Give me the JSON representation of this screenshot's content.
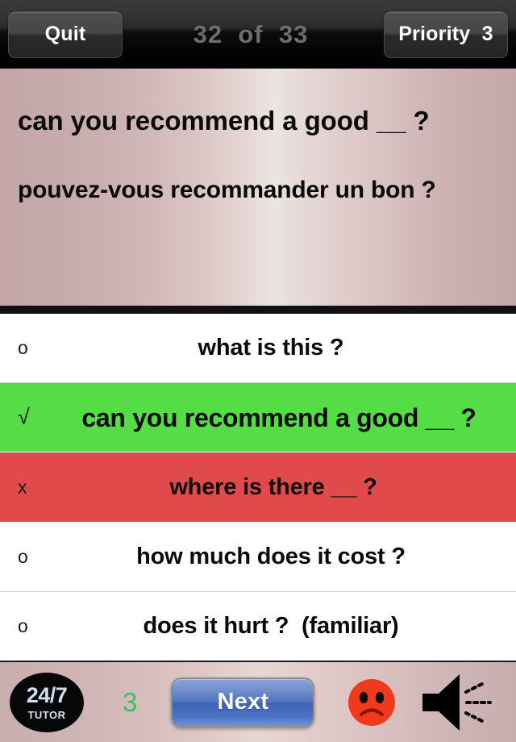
{
  "topbar": {
    "quit_label": "Quit",
    "counter": "32  of  33",
    "current_index": 32,
    "total": 33,
    "priority_label": "Priority  3"
  },
  "question": {
    "prompt_en": "can you recommend a good __ ?",
    "prompt_fr": "pouvez-vous recommander un bon ?"
  },
  "answers": [
    {
      "marker": "o",
      "text": "what is this ?",
      "state": "neutral"
    },
    {
      "marker": "√",
      "text": "can you recommend a good __ ?",
      "state": "correct"
    },
    {
      "marker": "x",
      "text": "where is there __ ?",
      "state": "wrong"
    },
    {
      "marker": "o",
      "text": "how much does it cost ?",
      "state": "neutral"
    },
    {
      "marker": "o",
      "text": "does it hurt ?  (familiar)",
      "state": "neutral"
    }
  ],
  "bottombar": {
    "logo_top": "24/7",
    "logo_bottom": "TUTOR",
    "score": "3",
    "next_label": "Next",
    "face_icon": "sad-face-icon",
    "speaker_icon": "speaker-icon"
  },
  "colors": {
    "correct_green": "#55dd45",
    "wrong_red": "#e04a4a",
    "score_green": "#2fc75c",
    "next_blue": "#4f74bf",
    "face_red": "#f03a1e",
    "panel_rose": "#c4a7a9"
  }
}
